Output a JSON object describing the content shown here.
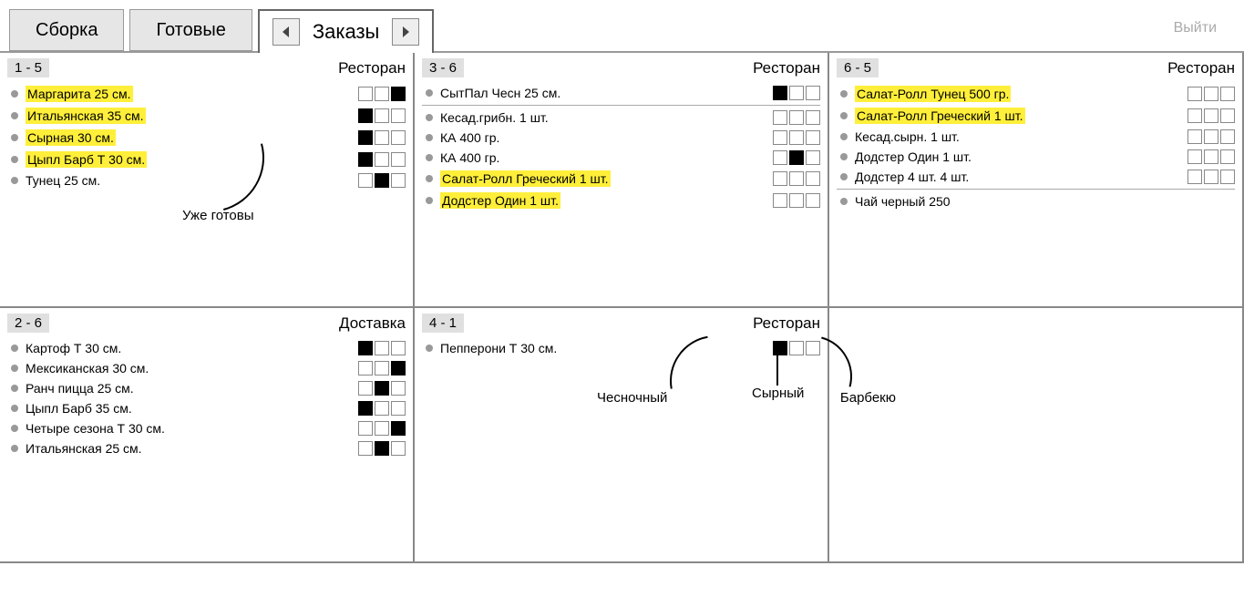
{
  "tabs": {
    "assembly": "Сборка",
    "ready": "Готовые",
    "orders": "Заказы"
  },
  "logout": "Выйти",
  "type_restaurant": "Ресторан",
  "type_delivery": "Доставка",
  "annotations": {
    "ready_label": "Уже готовы",
    "garlic": "Чесночный",
    "cheese": "Сырный",
    "bbq": "Барбекю"
  },
  "orders": [
    {
      "num": "1 - 5",
      "type": "Ресторан",
      "items": [
        {
          "name": "Маргарита 25 см.",
          "hl": true,
          "boxes": [
            0,
            0,
            1
          ]
        },
        {
          "name": "Итальянская 35 см.",
          "hl": true,
          "boxes": [
            1,
            0,
            0
          ]
        },
        {
          "name": "Сырная 30 см.",
          "hl": true,
          "boxes": [
            1,
            0,
            0
          ]
        },
        {
          "name": "Цыпл Барб Т 30 см.",
          "hl": true,
          "boxes": [
            1,
            0,
            0
          ]
        },
        {
          "name": "Тунец 25 см.",
          "hl": false,
          "boxes": [
            0,
            1,
            0
          ]
        }
      ]
    },
    {
      "num": "3 - 6",
      "type": "Ресторан",
      "items": [
        {
          "name": "СытПал Чесн 25 см.",
          "hl": false,
          "boxes": [
            1,
            0,
            0
          ]
        },
        {
          "name": "Кесад.грибн. 1 шт.",
          "hl": false,
          "boxes": [
            0,
            0,
            0
          ],
          "div_before": true
        },
        {
          "name": "КА 400 гр.",
          "hl": false,
          "boxes": [
            0,
            0,
            0
          ]
        },
        {
          "name": "КА 400 гр.",
          "hl": false,
          "boxes": [
            0,
            1,
            0
          ]
        },
        {
          "name": "Салат-Ролл Греческий 1 шт.",
          "hl": true,
          "boxes": [
            0,
            0,
            0
          ]
        },
        {
          "name": "Додстер Один 1 шт.",
          "hl": true,
          "boxes": [
            0,
            0,
            0
          ]
        }
      ]
    },
    {
      "num": "6 - 5",
      "type": "Ресторан",
      "items": [
        {
          "name": "Салат-Ролл Тунец 500 гр.",
          "hl": true,
          "boxes": [
            0,
            0,
            0
          ]
        },
        {
          "name": "Салат-Ролл Греческий 1 шт.",
          "hl": true,
          "boxes": [
            0,
            0,
            0
          ]
        },
        {
          "name": "Кесад.сырн. 1 шт.",
          "hl": false,
          "boxes": [
            0,
            0,
            0
          ]
        },
        {
          "name": "Додстер Один 1 шт.",
          "hl": false,
          "boxes": [
            0,
            0,
            0
          ]
        },
        {
          "name": "Додстер 4 шт. 4 шт.",
          "hl": false,
          "boxes": [
            0,
            0,
            0
          ]
        },
        {
          "name": "Чай черный 250",
          "hl": false,
          "boxes": null,
          "div_before": true
        }
      ]
    },
    {
      "num": "2 - 6",
      "type": "Доставка",
      "items": [
        {
          "name": "Картоф Т 30 см.",
          "hl": false,
          "boxes": [
            1,
            0,
            0
          ]
        },
        {
          "name": "Мексиканская 30 см.",
          "hl": false,
          "boxes": [
            0,
            0,
            1
          ]
        },
        {
          "name": "Ранч пицца 25 см.",
          "hl": false,
          "boxes": [
            0,
            1,
            0
          ]
        },
        {
          "name": "Цыпл Барб 35 см.",
          "hl": false,
          "boxes": [
            1,
            0,
            0
          ]
        },
        {
          "name": "Четыре сезона Т 30 см.",
          "hl": false,
          "boxes": [
            0,
            0,
            1
          ]
        },
        {
          "name": "Итальянская 25 см.",
          "hl": false,
          "boxes": [
            0,
            1,
            0
          ]
        }
      ]
    },
    {
      "num": "4 - 1",
      "type": "Ресторан",
      "items": [
        {
          "name": "Пепперони Т 30 см.",
          "hl": false,
          "boxes": [
            1,
            0,
            0
          ]
        }
      ]
    }
  ]
}
